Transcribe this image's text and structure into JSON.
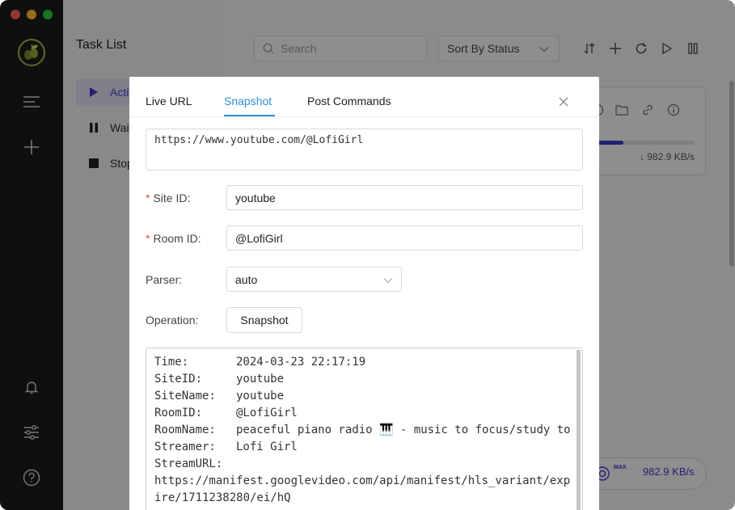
{
  "tasklist": {
    "title": "Task List",
    "items": [
      {
        "label": "Active",
        "icon": "play-icon"
      },
      {
        "label": "Waiting",
        "icon": "pause-icon"
      },
      {
        "label": "Stopped",
        "icon": "stop-icon"
      }
    ]
  },
  "toolbar": {
    "search_placeholder": "Search",
    "sort_label": "Sort By Status"
  },
  "task_card": {
    "progress": 0.6,
    "speed": "↓ 982.9 KB/s"
  },
  "speed_indicator": {
    "max_label": "MAX",
    "value": "982.9 KB/s"
  },
  "modal": {
    "tabs": [
      {
        "label": "Live URL",
        "active": false
      },
      {
        "label": "Snapshot",
        "active": true
      },
      {
        "label": "Post Commands",
        "active": false
      }
    ],
    "url": "https://www.youtube.com/@LofiGirl",
    "fields": {
      "site_id_label": "Site ID:",
      "site_id_value": "youtube",
      "room_id_label": "Room ID:",
      "room_id_value": "@LofiGirl",
      "parser_label": "Parser:",
      "parser_value": "auto",
      "operation_label": "Operation:",
      "operation_button": "Snapshot"
    },
    "output": [
      {
        "key": "Time:",
        "value": "2024-03-23 22:17:19"
      },
      {
        "key": "SiteID:",
        "value": "youtube"
      },
      {
        "key": "SiteName:",
        "value": "youtube"
      },
      {
        "key": "RoomID:",
        "value": "@LofiGirl"
      },
      {
        "key": "RoomName:",
        "value": "peaceful piano radio 🎹 - music to focus/study to"
      },
      {
        "key": "Streamer:",
        "value": "Lofi Girl"
      },
      {
        "key": "StreamURL:",
        "value": ""
      }
    ],
    "output_url": "https://manifest.googlevideo.com/api/manifest/hls_variant/expire/1711238280/ei/hQ"
  },
  "colors": {
    "accent": "#3f34c9",
    "tab_active": "#2f8fd6",
    "required": "#e5484d",
    "rail": "#1b1b1b"
  }
}
